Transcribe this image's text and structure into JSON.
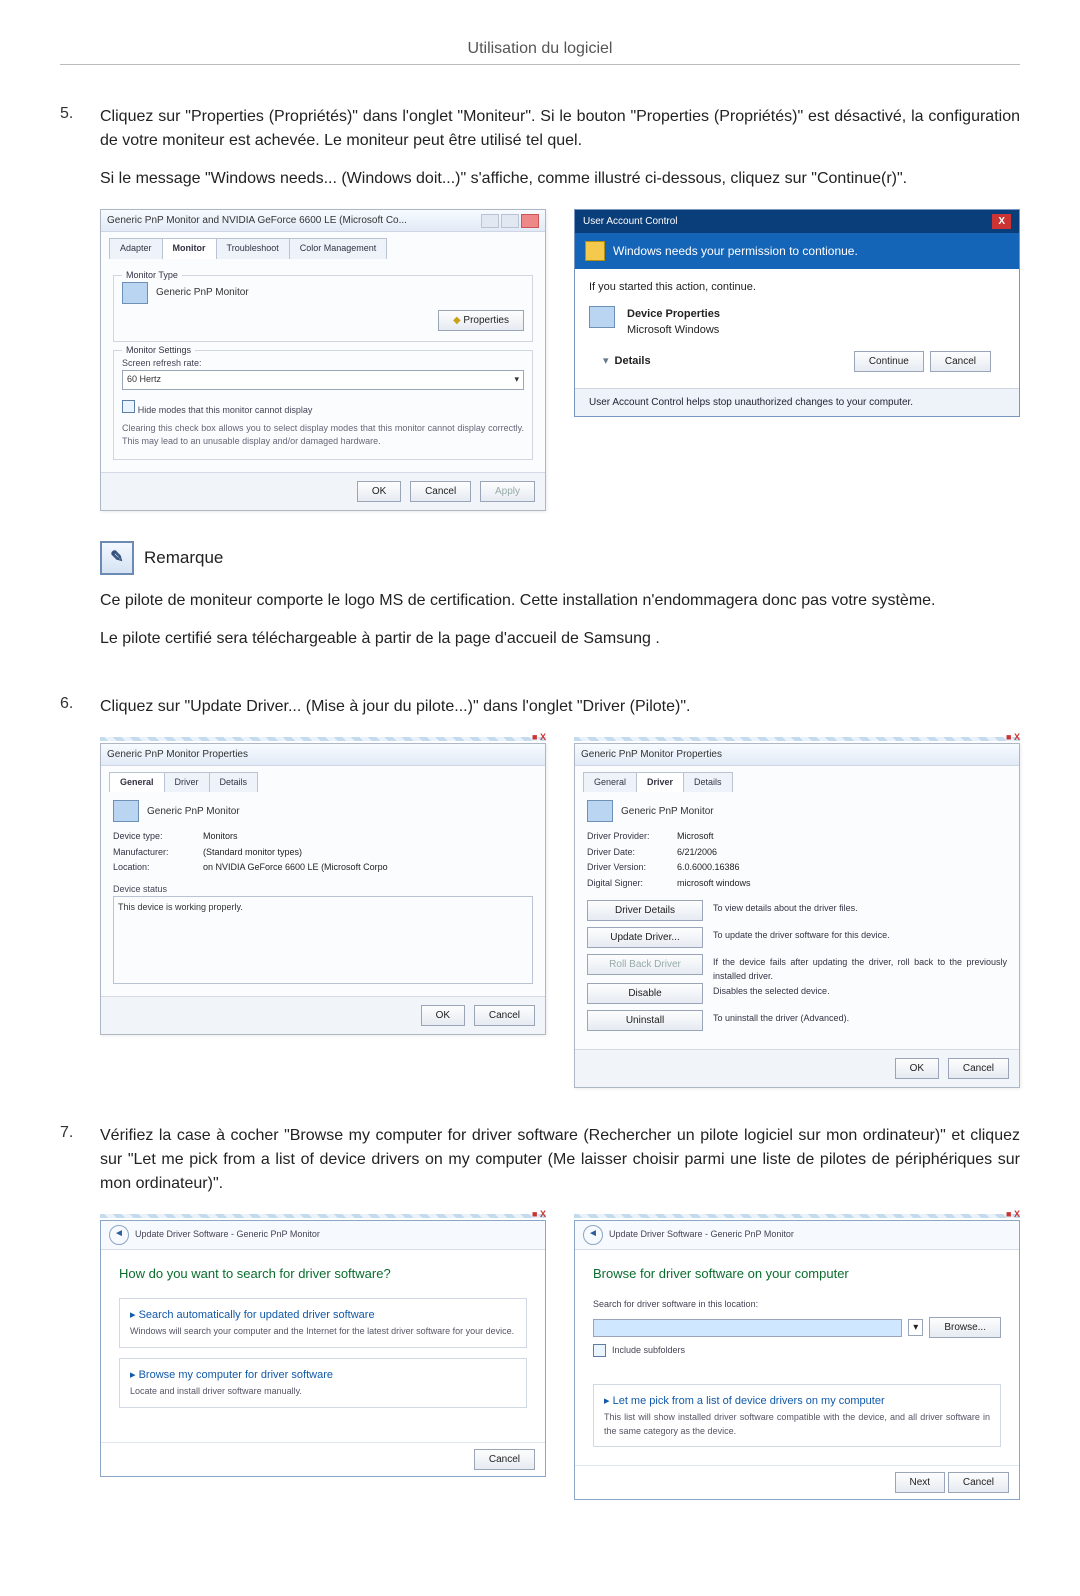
{
  "page_header": "Utilisation du logiciel",
  "steps": {
    "s5": {
      "num": "5.",
      "p1": "Cliquez sur \"Properties (Propriétés)\" dans l'onglet \"Moniteur\". Si le bouton \"Properties (Propriétés)\" est désactivé, la configuration de votre moniteur est achevée. Le moniteur peut être utilisé tel quel.",
      "p2": "Si le message \"Windows needs... (Windows doit...)\" s'affiche, comme illustré ci-dessous, cliquez sur \"Continue(r)\"."
    },
    "s6": {
      "num": "6.",
      "p1": "Cliquez sur \"Update Driver... (Mise à jour du pilote...)\" dans l'onglet \"Driver (Pilote)\"."
    },
    "s7": {
      "num": "7.",
      "p1": "Vérifiez la case à cocher \"Browse my computer for driver software (Rechercher un pilote logiciel sur mon ordinateur)\" et cliquez sur \"Let me pick from a list of device drivers on my computer (Me laisser choisir parmi une liste de pilotes de périphériques sur mon ordinateur)\"."
    }
  },
  "remarque": {
    "label": "Remarque",
    "p1": "Ce pilote de moniteur comporte le logo MS de certification. Cette installation n'endommagera donc pas votre système.",
    "p2": "Le pilote certifié sera téléchargeable à partir de la page d'accueil de Samsung ."
  },
  "dlg_monitor": {
    "title": "Generic PnP Monitor and NVIDIA GeForce 6600 LE (Microsoft Co...",
    "tabs": [
      "Adapter",
      "Monitor",
      "Troubleshoot",
      "Color Management"
    ],
    "group_type": "Monitor Type",
    "monitor_name": "Generic PnP Monitor",
    "properties_btn": "Properties",
    "group_settings": "Monitor Settings",
    "refresh_label": "Screen refresh rate:",
    "refresh_value": "60 Hertz",
    "hide_modes_chk": "Hide modes that this monitor cannot display",
    "hide_modes_desc": "Clearing this check box allows you to select display modes that this monitor cannot display correctly. This may lead to an unusable display and/or damaged hardware.",
    "ok": "OK",
    "cancel": "Cancel",
    "apply": "Apply"
  },
  "dlg_uac": {
    "title": "User Account Control",
    "band": "Windows needs your permission to contionue.",
    "started": "If you started this action, continue.",
    "prog_name": "Device Properties",
    "publisher": "Microsoft Windows",
    "details": "Details",
    "continue": "Continue",
    "cancel": "Cancel",
    "foot": "User Account Control helps stop unauthorized changes to your computer."
  },
  "dlg_prop_general": {
    "title": "Generic PnP Monitor Properties",
    "tabs": [
      "General",
      "Driver",
      "Details"
    ],
    "name": "Generic PnP Monitor",
    "kv": {
      "device_type_k": "Device type:",
      "device_type_v": "Monitors",
      "manufacturer_k": "Manufacturer:",
      "manufacturer_v": "(Standard monitor types)",
      "location_k": "Location:",
      "location_v": "on NVIDIA GeForce 6600 LE (Microsoft Corpo"
    },
    "status_label": "Device status",
    "status_text": "This device is working properly.",
    "ok": "OK",
    "cancel": "Cancel"
  },
  "dlg_prop_driver": {
    "title": "Generic PnP Monitor Properties",
    "tabs": [
      "General",
      "Driver",
      "Details"
    ],
    "name": "Generic PnP Monitor",
    "kv": {
      "provider_k": "Driver Provider:",
      "provider_v": "Microsoft",
      "date_k": "Driver Date:",
      "date_v": "6/21/2006",
      "version_k": "Driver Version:",
      "version_v": "6.0.6000.16386",
      "signer_k": "Digital Signer:",
      "signer_v": "microsoft windows"
    },
    "btns": {
      "details": "Driver Details",
      "details_d": "To view details about the driver files.",
      "update": "Update Driver...",
      "update_d": "To update the driver software for this device.",
      "rollback": "Roll Back Driver",
      "rollback_d": "If the device fails after updating the driver, roll back to the previously installed driver.",
      "disable": "Disable",
      "disable_d": "Disables the selected device.",
      "uninstall": "Uninstall",
      "uninstall_d": "To uninstall the driver (Advanced)."
    },
    "ok": "OK",
    "cancel": "Cancel"
  },
  "wiz_search": {
    "crumb": "Update Driver Software - Generic PnP Monitor",
    "head": "How do you want to search for driver software?",
    "opt1_t": "Search automatically for updated driver software",
    "opt1_d": "Windows will search your computer and the Internet for the latest driver software for your device.",
    "opt2_t": "Browse my computer for driver software",
    "opt2_d": "Locate and install driver software manually.",
    "cancel": "Cancel"
  },
  "wiz_browse": {
    "crumb": "Update Driver Software - Generic PnP Monitor",
    "head": "Browse for driver software on your computer",
    "loc_label": "Search for driver software in this location:",
    "browse": "Browse...",
    "include": "Include subfolders",
    "opt_t": "Let me pick from a list of device drivers on my computer",
    "opt_d": "This list will show installed driver software compatible with the device, and all driver software in the same category as the device.",
    "next": "Next",
    "cancel": "Cancel"
  }
}
